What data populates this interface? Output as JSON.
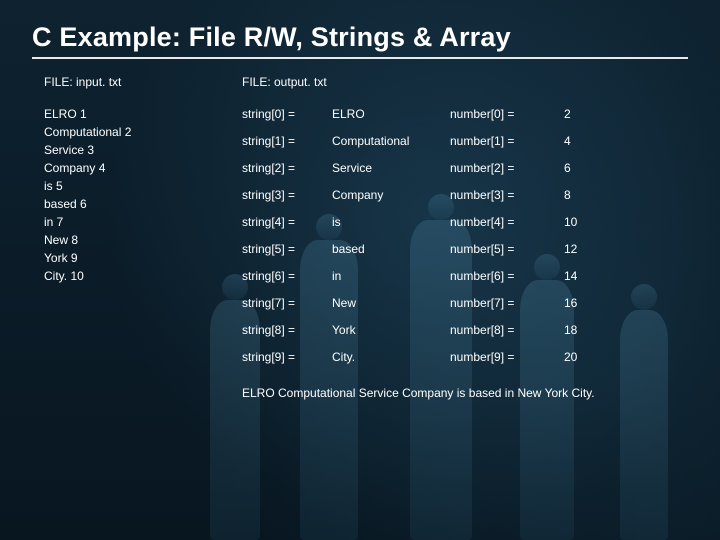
{
  "title": "C Example: File R/W, Strings & Array",
  "left": {
    "file_label": "FILE: input. txt",
    "lines": [
      "ELRO 1",
      "Computational 2",
      "Service 3",
      "Company 4",
      "is 5",
      "based 6",
      "in 7",
      "New 8",
      "York 9",
      "City. 10"
    ]
  },
  "right": {
    "file_label": "FILE: output. txt",
    "rows": [
      {
        "s_lhs": "string[0] =",
        "s_val": "ELRO",
        "n_lhs": "number[0] =",
        "n_val": "2"
      },
      {
        "s_lhs": "string[1] =",
        "s_val": "Computational",
        "n_lhs": "number[1] =",
        "n_val": "4"
      },
      {
        "s_lhs": "string[2] =",
        "s_val": "Service",
        "n_lhs": "number[2] =",
        "n_val": "6"
      },
      {
        "s_lhs": "string[3] =",
        "s_val": "Company",
        "n_lhs": "number[3] =",
        "n_val": "8"
      },
      {
        "s_lhs": "string[4] =",
        "s_val": "is",
        "n_lhs": "number[4] =",
        "n_val": "10"
      },
      {
        "s_lhs": "string[5] =",
        "s_val": "based",
        "n_lhs": "number[5] =",
        "n_val": "12"
      },
      {
        "s_lhs": "string[6] =",
        "s_val": "in",
        "n_lhs": "number[6] =",
        "n_val": "14"
      },
      {
        "s_lhs": "string[7] =",
        "s_val": "New",
        "n_lhs": "number[7] =",
        "n_val": "16"
      },
      {
        "s_lhs": "string[8] =",
        "s_val": "York",
        "n_lhs": "number[8] =",
        "n_val": "18"
      },
      {
        "s_lhs": "string[9] =",
        "s_val": "City.",
        "n_lhs": "number[9] =",
        "n_val": "20"
      }
    ],
    "summary": "ELRO Computational Service Company is based in New York City."
  }
}
